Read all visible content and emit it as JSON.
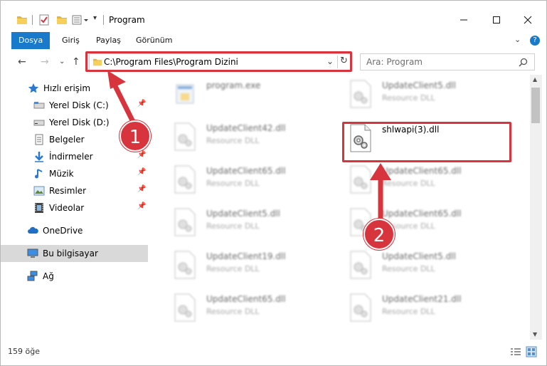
{
  "window": {
    "title": "Program",
    "controls": [
      "minimize",
      "maximize",
      "close"
    ]
  },
  "ribbon": {
    "tabs": [
      {
        "label": "Dosya",
        "active": true
      },
      {
        "label": "Giriş",
        "active": false
      },
      {
        "label": "Paylaş",
        "active": false
      },
      {
        "label": "Görünüm",
        "active": false
      }
    ]
  },
  "address": {
    "path": "C:\\Program Files\\Program Dizini",
    "search_placeholder": "Ara: Program"
  },
  "sidebar": {
    "items": [
      {
        "label": "Hızlı erişim",
        "icon": "star-icon",
        "pinned": false
      },
      {
        "label": "Yerel Disk (C:)",
        "icon": "drive-icon",
        "pinned": true
      },
      {
        "label": "Yerel Disk (D:)",
        "icon": "drive-icon",
        "pinned": true
      },
      {
        "label": "Belgeler",
        "icon": "documents-icon",
        "pinned": true
      },
      {
        "label": "İndirmeler",
        "icon": "download-icon",
        "pinned": true
      },
      {
        "label": "Müzik",
        "icon": "music-icon",
        "pinned": true
      },
      {
        "label": "Resimler",
        "icon": "pictures-icon",
        "pinned": true
      },
      {
        "label": "Videolar",
        "icon": "video-icon",
        "pinned": true
      },
      {
        "label": "OneDrive",
        "icon": "cloud-icon",
        "pinned": false
      },
      {
        "label": "Bu bilgisayar",
        "icon": "computer-icon",
        "pinned": false,
        "selected": true
      },
      {
        "label": "Ağ",
        "icon": "network-icon",
        "pinned": false
      }
    ]
  },
  "files": {
    "left_column": [
      {
        "name": "program.exe",
        "type": ""
      },
      {
        "name": "UpdateClient42.dll",
        "type": "Resource DLL"
      },
      {
        "name": "UpdateClient65.dll",
        "type": "Resource DLL"
      },
      {
        "name": "UpdateClient5.dll",
        "type": "Resource DLL"
      },
      {
        "name": "UpdateClient19.dll",
        "type": "Resource DLL"
      },
      {
        "name": "UpdateClient65.dll",
        "type": "Resource DLL"
      }
    ],
    "right_column": [
      {
        "name": "UpdateClient5.dll",
        "type": "Resource DLL"
      },
      {
        "name": "shlwapi(3).dll",
        "type": ""
      },
      {
        "name": "UpdateClient65.dll",
        "type": "Resource DLL"
      },
      {
        "name": "UpdateClient65.dll",
        "type": "Resource DLL"
      },
      {
        "name": "UpdateClient5.dll",
        "type": "Resource DLL"
      },
      {
        "name": "UpdateClient21.dll",
        "type": "Resource DLL"
      }
    ]
  },
  "status": {
    "item_count": "159 öğe"
  },
  "annotations": {
    "step1": "1",
    "step2": "2",
    "color": "#d8343d"
  }
}
